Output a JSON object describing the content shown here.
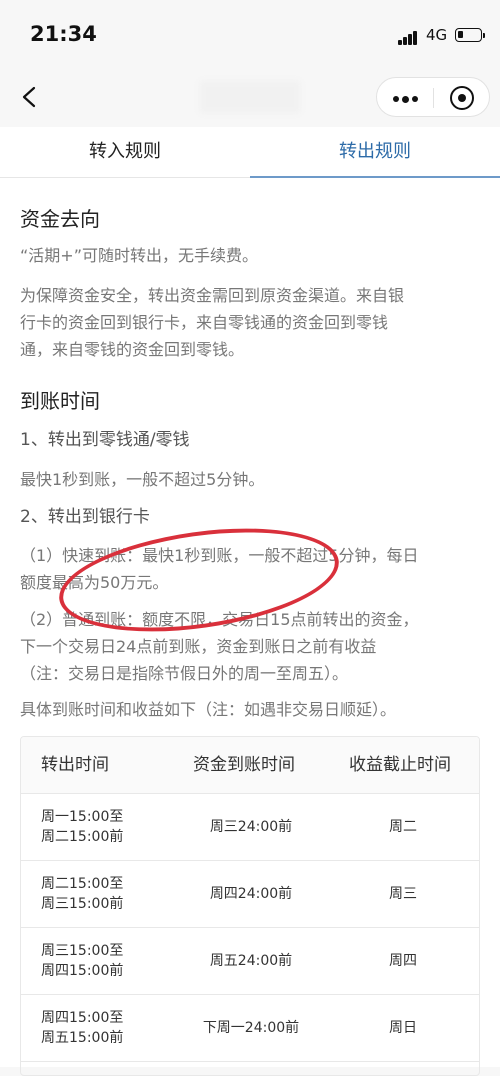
{
  "status_bar": {
    "time": "21:34",
    "network": "4G"
  },
  "tabs": [
    {
      "label": "转入规则"
    },
    {
      "label": "转出规则"
    }
  ],
  "sections": {
    "destination": {
      "heading": "资金去向",
      "para1": "“活期+”可随时转出，无手续费。",
      "para2_lines": [
        "为保障资金安全，转出资金需回到原资金渠道。来自银",
        "行卡的资金回到银行卡，来自零钱通的资金回到零钱",
        "通，来自零钱的资金回到零钱。"
      ]
    },
    "arrival": {
      "heading": "到账时间",
      "item1_title": "1、转出到零钱通/零钱",
      "item1_text": "最快1秒到账，一般不超过5分钟。",
      "item2_title": "2、转出到银行卡",
      "fast_lines": [
        "（1）快速到账：最快1秒到账，一般不超过5分钟，每日",
        "额度最高为50万元。"
      ],
      "normal_lines": [
        "（2）普通到账：额度不限，交易日15点前转出的资金，",
        "下一个交易日24点前到账，资金到账日之前有收益",
        "（注：交易日是指除节假日外的周一至周五）。"
      ],
      "table_note": "具体到账时间和收益如下（注：如遇非交易日顺延）。"
    }
  },
  "table": {
    "headers": [
      "转出时间",
      "资金到账时间",
      "收益截止时间"
    ],
    "rows": [
      {
        "from": "周一15:00至",
        "to": "周二15:00前",
        "arrival": "周三24:00前",
        "cutoff": "周二"
      },
      {
        "from": "周二15:00至",
        "to": "周三15:00前",
        "arrival": "周四24:00前",
        "cutoff": "周三"
      },
      {
        "from": "周三15:00至",
        "to": "周四15:00前",
        "arrival": "周五24:00前",
        "cutoff": "周四"
      },
      {
        "from": "周四15:00至",
        "to": "周五15:00前",
        "arrival": "下周一24:00前",
        "cutoff": "周日"
      }
    ]
  },
  "colors": {
    "active_tab": "#2d6ba8",
    "annotation_circle": "#d9303b"
  }
}
